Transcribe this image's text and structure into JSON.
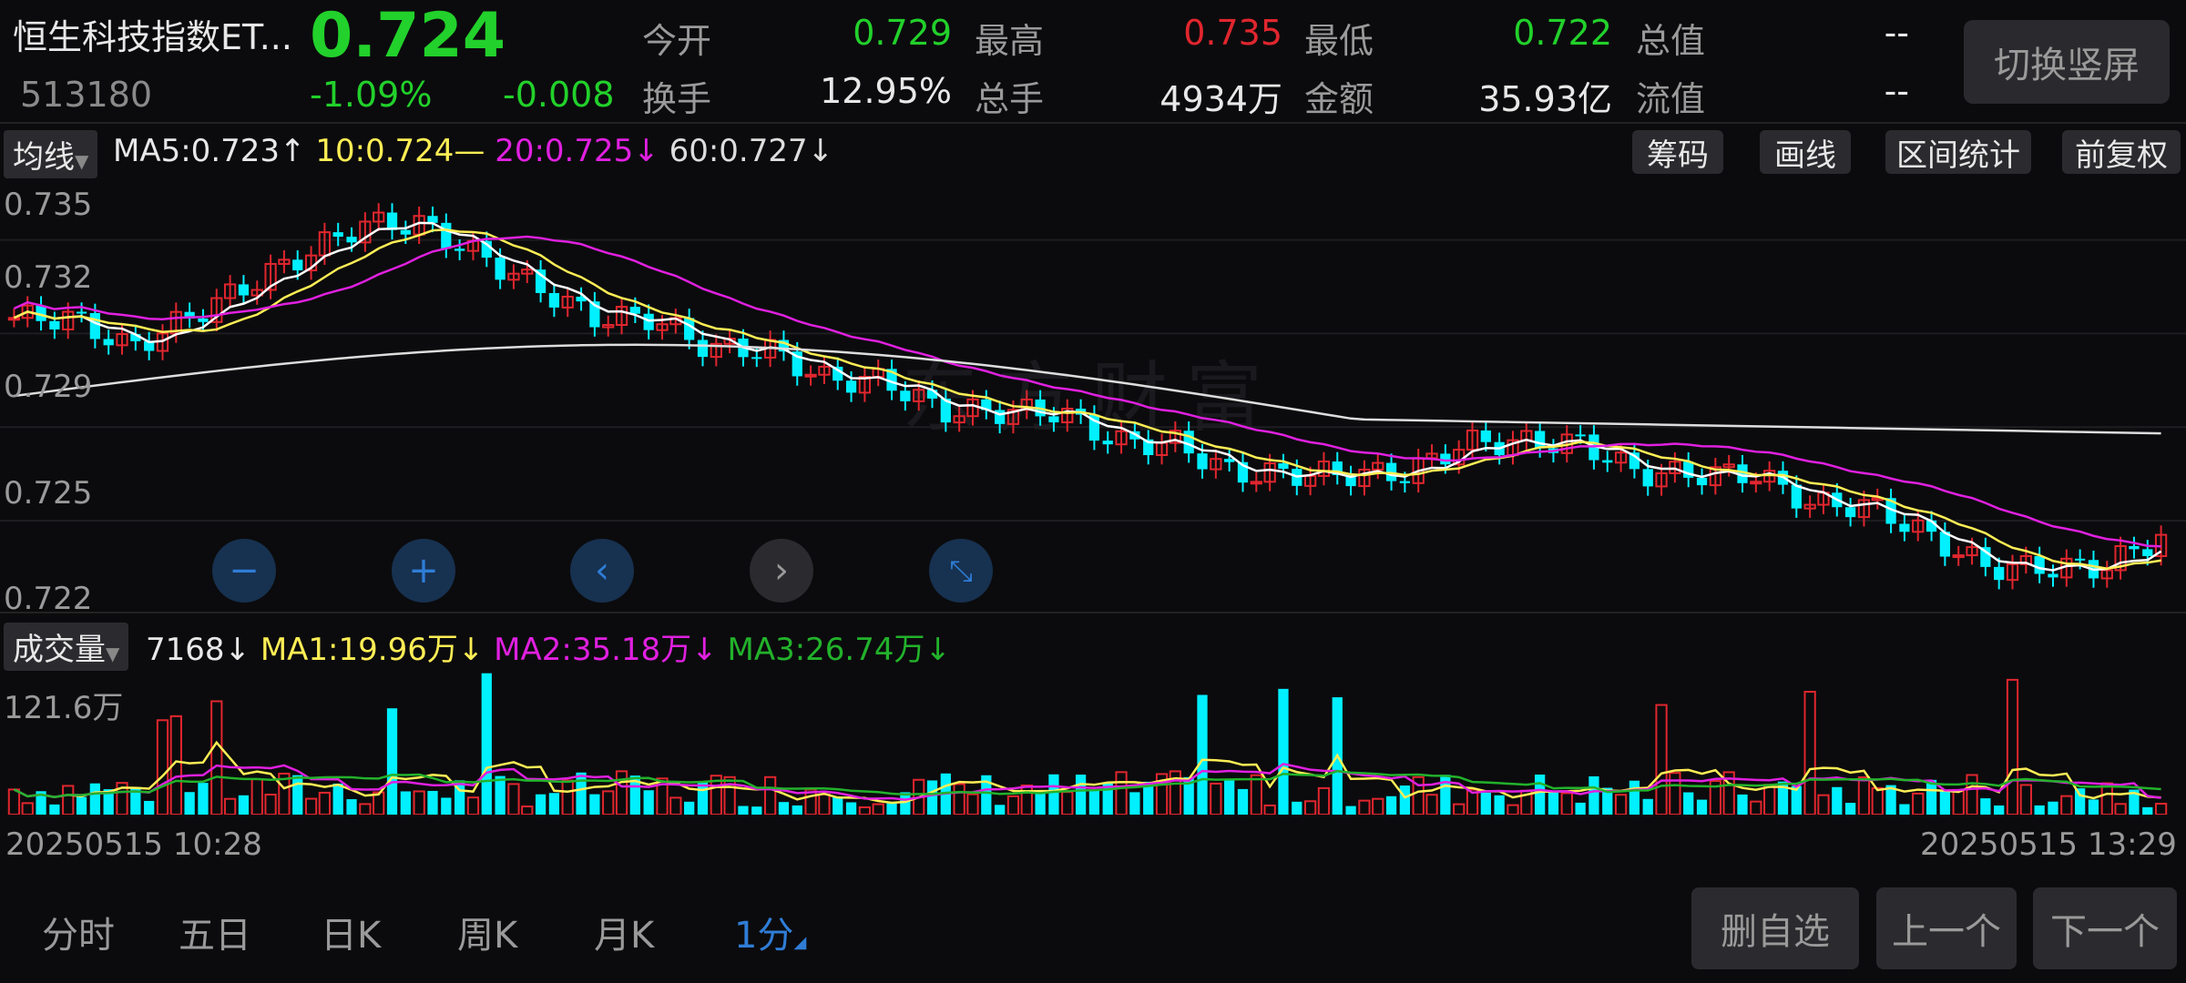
{
  "header": {
    "name": "恒生科技指数ET...",
    "code": "513180",
    "price": "0.724",
    "change_pct": "-1.09%",
    "change": "-0.008",
    "stats": {
      "open_label": "今开",
      "open": "0.729",
      "high_label": "最高",
      "high": "0.735",
      "low_label": "最低",
      "low": "0.722",
      "total_value_label": "总值",
      "total_value": "--",
      "turnover_label": "换手",
      "turnover": "12.95%",
      "total_hands_label": "总手",
      "total_hands": "4934万",
      "amount_label": "金额",
      "amount": "35.93亿",
      "float_value_label": "流值",
      "float_value": "--"
    },
    "portrait_button": "切换竖屏"
  },
  "ma_bar": {
    "selector": "均线",
    "ma5": "MA5:0.723↑",
    "ma10": "10:0.724—",
    "ma20": "20:0.725↓",
    "ma60": "60:0.727↓",
    "tools": [
      "筹码",
      "画线",
      "区间统计",
      "前复权"
    ]
  },
  "price_axis": [
    "0.735",
    "0.732",
    "0.729",
    "0.725",
    "0.722"
  ],
  "volume_bar": {
    "selector": "成交量",
    "vol": "7168↓",
    "ma1": "MA1:19.96万↓",
    "ma2": "MA2:35.18万↓",
    "ma3": "MA3:26.74万↓",
    "max_label": "121.6万"
  },
  "time_axis": {
    "start": "20250515 10:28",
    "end": "20250515 13:29"
  },
  "watermark": "东方财富",
  "chart_controls": [
    "zoom-out",
    "zoom-in",
    "scroll-left",
    "scroll-right",
    "collapse"
  ],
  "nav": [
    "分时",
    "五日",
    "日K",
    "周K",
    "月K",
    "1分"
  ],
  "nav_active": "1分",
  "bottom_buttons": [
    "删自选",
    "上一个",
    "下一个"
  ],
  "colors": {
    "up": "#e0262e",
    "down": "#00f0ff",
    "ma5": "#ffffff",
    "ma10": "#ffee55",
    "ma20": "#e020e0",
    "ma60": "#dddddd",
    "ma3": "#22b22b"
  },
  "chart_data": {
    "type": "candlestick",
    "x_range": [
      "20250515 10:28",
      "20250515 13:29"
    ],
    "ylim": [
      0.722,
      0.735
    ],
    "close_path": [
      0.731,
      0.731,
      0.73,
      0.731,
      0.732,
      0.733,
      0.734,
      0.734,
      0.733,
      0.732,
      0.731,
      0.731,
      0.73,
      0.73,
      0.729,
      0.729,
      0.728,
      0.728,
      0.728,
      0.727,
      0.727,
      0.726,
      0.726,
      0.726,
      0.726,
      0.727,
      0.727,
      0.727,
      0.726,
      0.726,
      0.726,
      0.725,
      0.725,
      0.724,
      0.723,
      0.723,
      0.723,
      0.724
    ],
    "volume_max": "121.6万"
  }
}
